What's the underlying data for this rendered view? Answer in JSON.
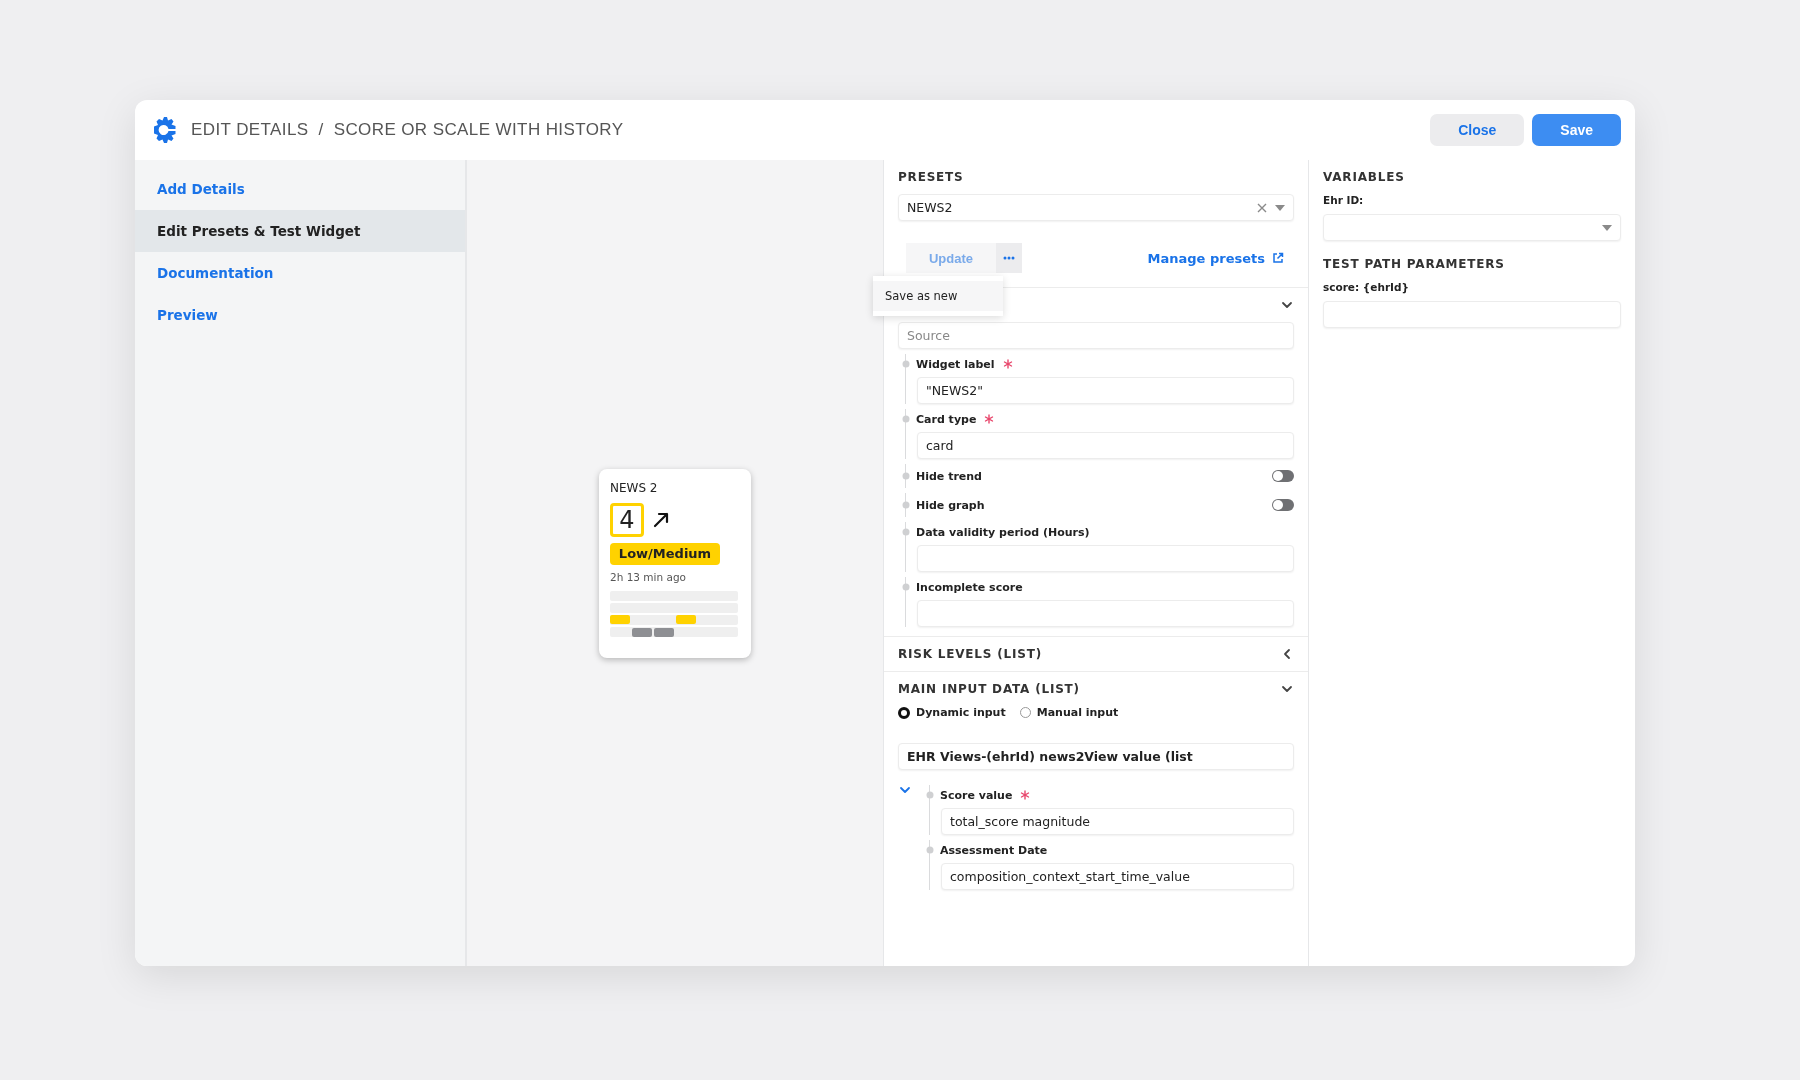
{
  "header": {
    "breadcrumb": [
      {
        "label": "EDIT DETAILS"
      },
      {
        "label": "SCORE OR SCALE WITH HISTORY"
      }
    ],
    "separator": "/",
    "buttons": [
      {
        "label": "Close",
        "kind": "secondary"
      },
      {
        "label": "Save",
        "kind": "primary"
      }
    ]
  },
  "sidebar": {
    "items": [
      {
        "label": "Add Details",
        "selected": false
      },
      {
        "label": "Edit Presets & Test Widget",
        "selected": true
      },
      {
        "label": "Documentation",
        "selected": false
      },
      {
        "label": "Preview",
        "selected": false
      }
    ]
  },
  "preview_card": {
    "title": "NEWS 2",
    "score": "4",
    "rising": true,
    "risk": {
      "label": "Low/Medium",
      "color": "#ffd200"
    },
    "updated": "2h 13 min ago"
  },
  "presets": {
    "title": "PRESETS",
    "select": {
      "value": "NEWS2"
    },
    "update_button": {
      "label": "Update",
      "disabled": true
    },
    "manage_link": {
      "label": "Manage presets"
    },
    "menu": {
      "open": true,
      "items": [
        {
          "label": "Save as new"
        }
      ]
    }
  },
  "config_section": {
    "expanded": true,
    "source": {
      "placeholder": "Source"
    },
    "properties": [
      {
        "kind": "field",
        "label": "Widget label",
        "required": true,
        "value": "\"NEWS2\""
      },
      {
        "kind": "field",
        "label": "Card type",
        "required": true,
        "value": "card"
      },
      {
        "kind": "toggle",
        "label": "Hide trend",
        "on": false
      },
      {
        "kind": "toggle",
        "label": "Hide graph",
        "on": false
      },
      {
        "kind": "field",
        "label": "Data validity period (Hours)",
        "required": false
      },
      {
        "kind": "field",
        "label": "Incomplete score",
        "required": false
      }
    ]
  },
  "risk_levels": {
    "title": "RISK LEVELS (LIST)",
    "expanded": false
  },
  "main_input": {
    "title": "MAIN INPUT DATA (LIST)",
    "expanded": true,
    "modes": [
      {
        "label": "Dynamic input",
        "selected": true
      },
      {
        "label": "Manual input",
        "selected": false
      }
    ],
    "source": {
      "value": "EHR Views-(ehrId) news2View value (list"
    },
    "tree": {
      "expanded": true,
      "children": [
        {
          "label": "Score value",
          "required": true,
          "value": "total_score magnitude"
        },
        {
          "label": "Assessment Date",
          "required": false,
          "value": "composition_context_start_time_value"
        }
      ]
    }
  },
  "variables": {
    "title": "VARIABLES",
    "fields": [
      {
        "label": "Ehr ID:",
        "kind": "select"
      }
    ]
  },
  "test_path_parameters": {
    "title": "TEST PATH PARAMETERS",
    "fields": [
      {
        "label": "score: {ehrId}",
        "kind": "input"
      }
    ]
  }
}
